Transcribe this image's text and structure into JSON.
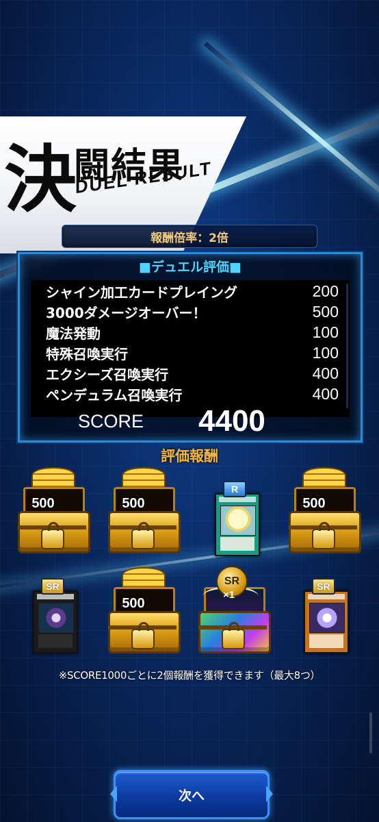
{
  "header": {
    "title_kanji_big": "決",
    "title_kanji_rest": "闘結果",
    "title_en": "DUEL RESULT"
  },
  "multiplier": {
    "text": "報酬倍率：2倍"
  },
  "evaluation": {
    "title": "■デュエル評価■",
    "items": [
      {
        "label": "シャイン加工カードプレイング",
        "points": "200"
      },
      {
        "label": "3000ダメージオーバー！",
        "points": "500"
      },
      {
        "label": "魔法発動",
        "points": "100"
      },
      {
        "label": "特殊召喚実行",
        "points": "100"
      },
      {
        "label": "エクシーズ召喚実行",
        "points": "400"
      },
      {
        "label": "ペンデュラム召喚実行",
        "points": "400"
      }
    ],
    "score_label": "SCORE",
    "score_value": "4400"
  },
  "rewards": {
    "title": "評価報酬",
    "items": [
      {
        "type": "gem-chest",
        "quantity": "500"
      },
      {
        "type": "gem-chest",
        "quantity": "500"
      },
      {
        "type": "card",
        "rarity": "R",
        "frame": "spell"
      },
      {
        "type": "gem-chest",
        "quantity": "500"
      },
      {
        "type": "card",
        "rarity": "SR",
        "frame": "xyz"
      },
      {
        "type": "gem-chest",
        "quantity": "500"
      },
      {
        "type": "sr-ticket-chest",
        "medal": "SR",
        "quantity": "×1"
      },
      {
        "type": "card",
        "rarity": "SR",
        "frame": "effect"
      }
    ],
    "note": "※SCORE1000ごとに2個報酬を獲得できます（最大8つ）"
  },
  "footer": {
    "next_label": "次へ"
  },
  "colors": {
    "accent_blue": "#2c8ad8",
    "title_cyan": "#4fd3ff",
    "reward_orange": "#f6b73c",
    "multiplier_gold": "#f2c97a"
  }
}
